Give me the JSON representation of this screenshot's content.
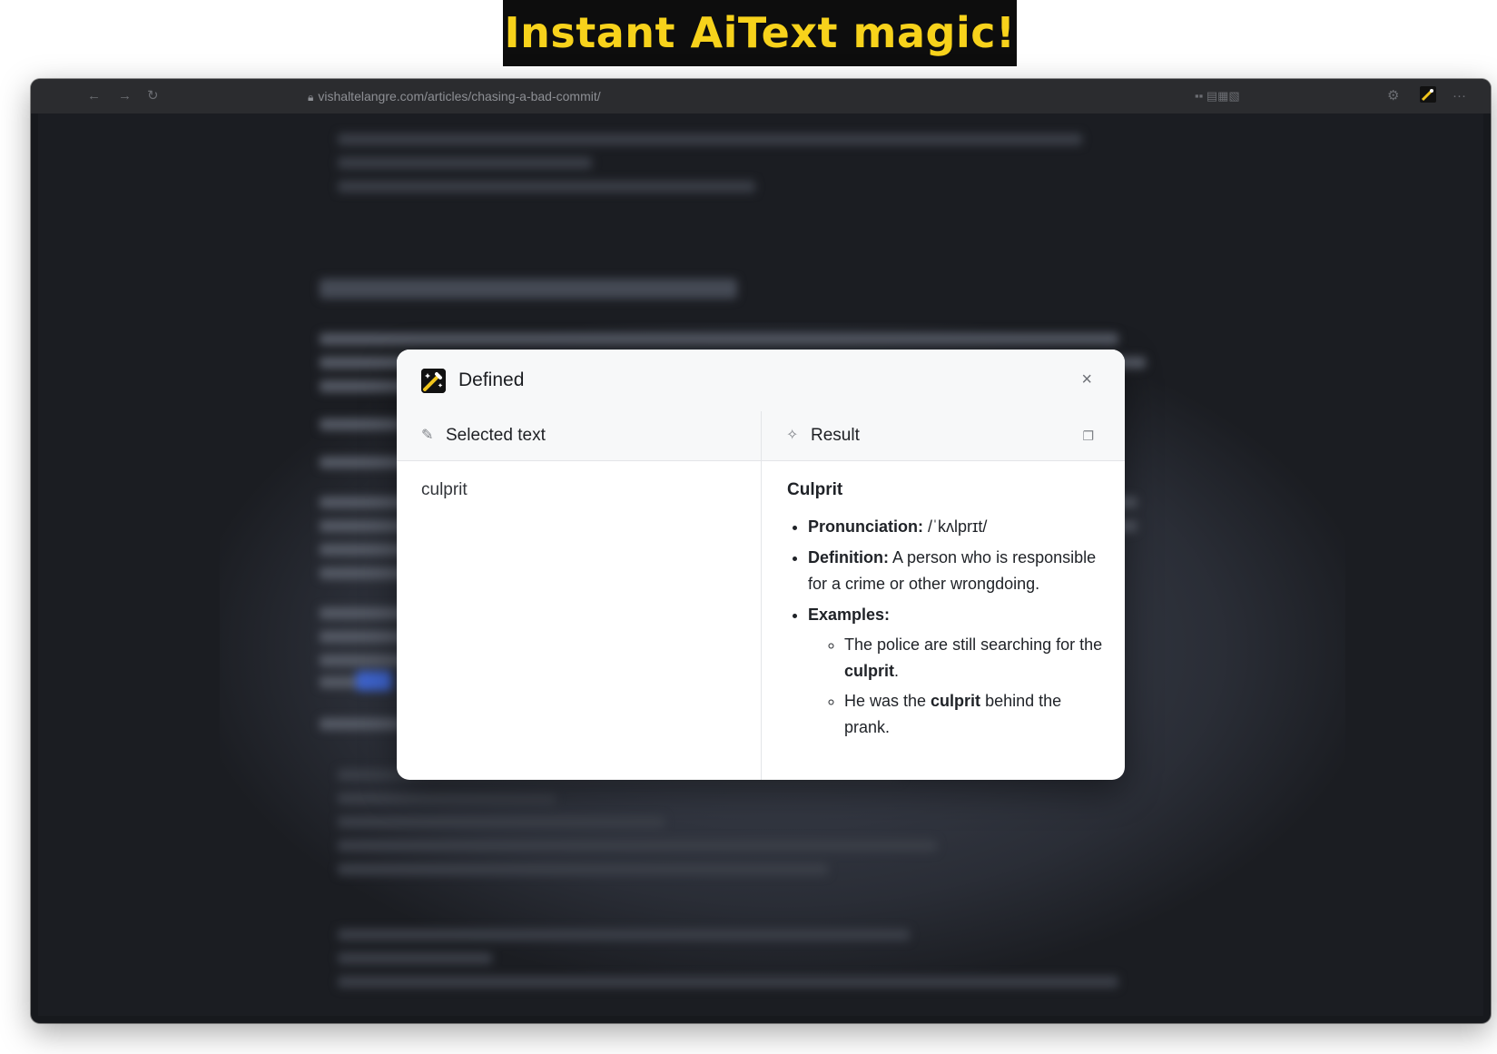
{
  "banner": {
    "text": "Instant AiText magic!"
  },
  "browser": {
    "url": "vishaltelangre.com/articles/chasing-a-bad-commit/",
    "icons": [
      "back-arrow-icon",
      "forward-arrow-icon",
      "reload-icon",
      "lock-icon",
      "extensions-icon",
      "settings-icon",
      "aitext-extension-icon",
      "more-icon"
    ]
  },
  "modal": {
    "title": "Defined",
    "close_label": "×",
    "selected_header": "Selected text",
    "result_header": "Result",
    "selected_text": "culprit",
    "result": {
      "word": "Culprit",
      "pronunciation_label": "Pronunciation:",
      "pronunciation": "/ˈkʌlprɪt/",
      "definition_label": "Definition:",
      "definition": "A person who is responsible for a crime or other wrongdoing.",
      "examples_label": "Examples:",
      "examples": [
        {
          "before": "The police are still searching for the ",
          "bold": "culprit",
          "after": "."
        },
        {
          "before": "He was the ",
          "bold": "culprit",
          "after": " behind the prank."
        }
      ]
    }
  },
  "colors": {
    "banner_bg": "#0d0d0d",
    "banner_text": "#f7d21b",
    "page_bg": "#1b1d22",
    "modal_bg": "#ffffff"
  }
}
